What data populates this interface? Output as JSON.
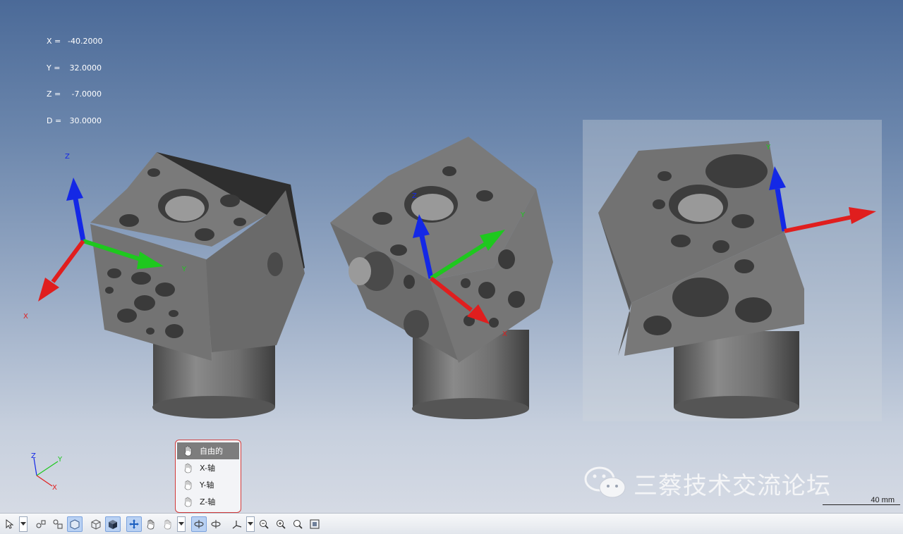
{
  "coords": {
    "rows": [
      {
        "key": "X =",
        "value": "-40.2000"
      },
      {
        "key": "Y =",
        "value": "32.0000"
      },
      {
        "key": "Z =",
        "value": "-7.0000"
      },
      {
        "key": "D =",
        "value": "30.0000"
      }
    ]
  },
  "axes_labels": {
    "x": "X",
    "y": "Y",
    "z": "Z"
  },
  "colors": {
    "x_axis": "#e01e1e",
    "y_axis": "#1ec81e",
    "z_axis": "#1428e6",
    "part": "#6f6f6f",
    "menu_border": "#d23a3a"
  },
  "rotate_menu": {
    "items": [
      {
        "label": "自由的",
        "icon": "hand-free-icon",
        "selected": true
      },
      {
        "label": "X-轴",
        "icon": "hand-x-icon",
        "selected": false
      },
      {
        "label": "Y-轴",
        "icon": "hand-y-icon",
        "selected": false
      },
      {
        "label": "Z-轴",
        "icon": "hand-z-icon",
        "selected": false
      }
    ]
  },
  "watermark": {
    "text": "三蔡技术交流论坛",
    "icon": "wechat-icon"
  },
  "scale_bar": {
    "label": "40 mm"
  },
  "toolbar": {
    "buttons": [
      {
        "name": "select-icon",
        "dropdown": true
      },
      {
        "name": "view-orient-icon"
      },
      {
        "name": "view-orient-2-icon"
      },
      {
        "name": "cube-view-icon",
        "active": true
      },
      {
        "name": "wireframe-icon"
      },
      {
        "name": "shaded-icon",
        "active": true
      },
      {
        "name": "pan-icon",
        "active": true
      },
      {
        "name": "hand-icon"
      },
      {
        "name": "rotate-axis-icon",
        "dropdown": true
      },
      {
        "name": "rotate-left-icon",
        "active": true
      },
      {
        "name": "rotate-right-icon"
      },
      {
        "name": "triad-icon",
        "dropdown": true
      },
      {
        "name": "zoom-out-icon"
      },
      {
        "name": "zoom-in-icon"
      },
      {
        "name": "zoom-icon"
      },
      {
        "name": "zoom-fit-icon"
      }
    ]
  }
}
